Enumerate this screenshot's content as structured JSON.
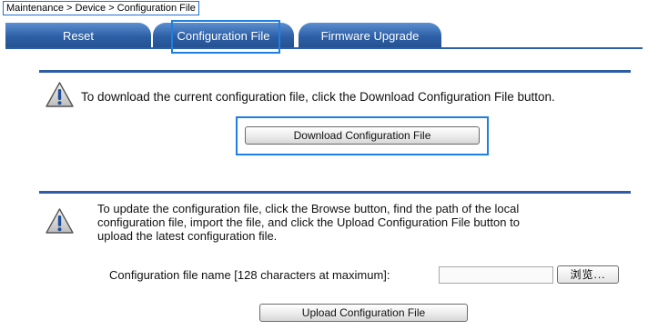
{
  "breadcrumb": "Maintenance > Device > Configuration File",
  "tabs": [
    {
      "label": "Reset"
    },
    {
      "label": "Configuration File"
    },
    {
      "label": "Firmware Upgrade"
    }
  ],
  "download": {
    "message": "To download the current configuration file, click the Download Configuration File button.",
    "button_label": "Download Configuration File"
  },
  "upload": {
    "message_lines": [
      "To update the configuration file, click the Browse button, find the path of the local",
      "configuration file, import the file, and click the Upload Configuration File button to",
      "upload the latest configuration file."
    ],
    "file_field_label": "Configuration file name [128 characters at maximum]:",
    "file_field_value": "",
    "browse_label": "浏览...",
    "button_label": "Upload Configuration File"
  },
  "colors": {
    "tab_blue": "#2d5fa6",
    "highlight": "#1f7fe0"
  }
}
